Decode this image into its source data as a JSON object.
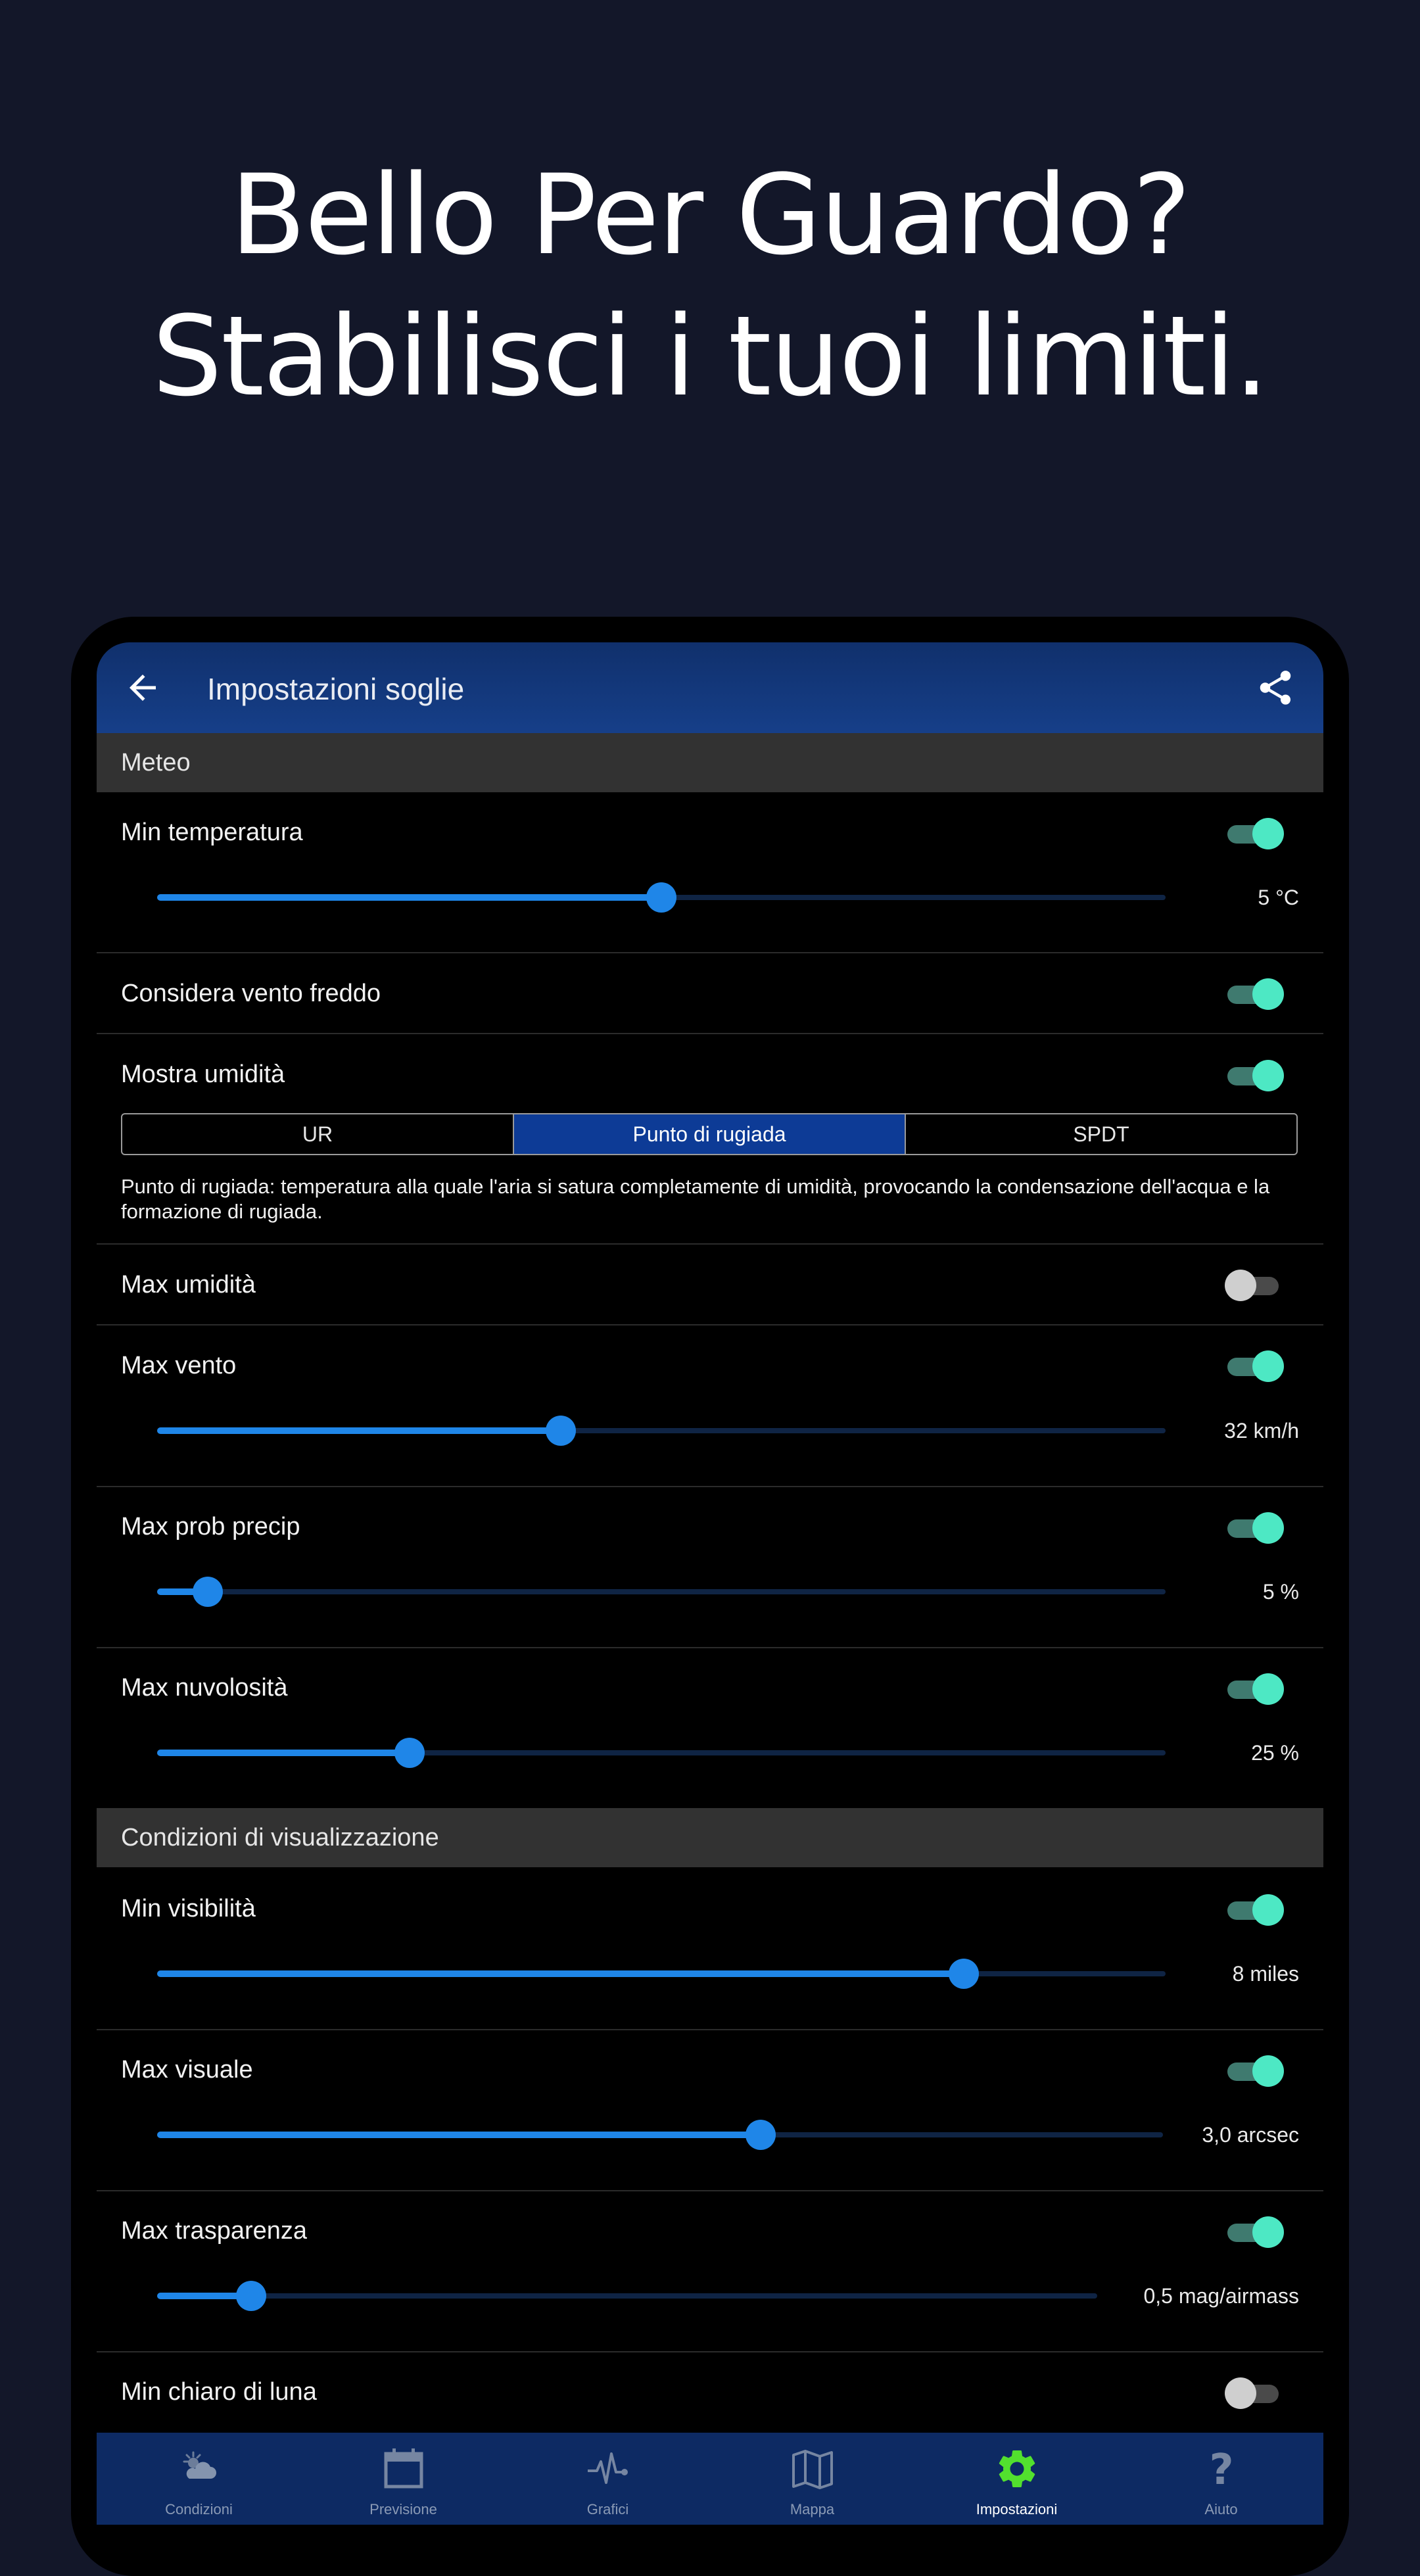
{
  "headline": {
    "line1": "Bello Per Guardo?",
    "line2": "Stabilisci i tuoi limiti."
  },
  "appbar": {
    "title": "Impostazioni soglie",
    "back_icon": "arrow-left-icon",
    "share_icon": "share-icon"
  },
  "sections": {
    "weather": "Meteo",
    "viewing": "Condizioni di visualizzazione"
  },
  "settings": {
    "min_temp": {
      "label": "Min temperatura",
      "enabled": true,
      "value": "5 °C",
      "level": 0.5
    },
    "wind_chill": {
      "label": "Considera vento freddo",
      "enabled": true
    },
    "humidity": {
      "label": "Mostra umidità",
      "enabled": true,
      "options": [
        "UR",
        "Punto di rugiada",
        "SPDT"
      ],
      "selected": "Punto di rugiada",
      "description": "Punto di rugiada: temperatura alla quale l'aria si satura completamente di umidità, provocando la condensazione dell'acqua e la formazione di rugiada."
    },
    "max_humidity": {
      "label": "Max umidità",
      "enabled": false
    },
    "max_wind": {
      "label": "Max vento",
      "enabled": true,
      "value": "32 km/h",
      "level": 0.4
    },
    "max_precip": {
      "label": "Max prob precip",
      "enabled": true,
      "value": "5 %",
      "level": 0.05
    },
    "max_cloud": {
      "label": "Max nuvolosità",
      "enabled": true,
      "value": "25 %",
      "level": 0.25
    },
    "min_visibility": {
      "label": "Min visibilità",
      "enabled": true,
      "value": "8 miles",
      "level": 0.8
    },
    "max_seeing": {
      "label": "Max visuale",
      "enabled": true,
      "value": "3,0 arcsec",
      "level": 0.6
    },
    "max_transparency": {
      "label": "Max trasparenza",
      "enabled": true,
      "value": "0,5 mag/airmass",
      "level": 0.1
    },
    "min_moonlight": {
      "label": "Min chiaro di luna",
      "enabled": false
    }
  },
  "nav": [
    {
      "label": "Condizioni",
      "icon": "partly-cloudy-icon",
      "active": false
    },
    {
      "label": "Previsione",
      "icon": "calendar-icon",
      "active": false
    },
    {
      "label": "Grafici",
      "icon": "pulse-chart-icon",
      "active": false
    },
    {
      "label": "Mappa",
      "icon": "map-icon",
      "active": false
    },
    {
      "label": "Impostazioni",
      "icon": "gear-icon",
      "active": true
    },
    {
      "label": "Aiuto",
      "icon": "help-icon",
      "active": false
    }
  ],
  "colors": {
    "accent": "#1f86e8",
    "toggle_on": "#4de8c4",
    "nav_active": "#52e02e",
    "appbar": "#163f89"
  }
}
